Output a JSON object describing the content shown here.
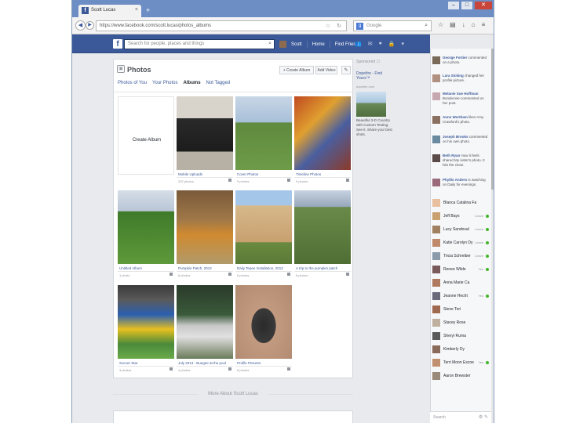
{
  "browser": {
    "tab_title": "Scott Lucas",
    "new_tab_glyph": "+",
    "close_glyph": "×",
    "url": "https://www.facebook.com/scott.lucas/photos_albums",
    "search_placeholder": "Google",
    "window_buttons": [
      "–",
      "□",
      "✕"
    ]
  },
  "fb": {
    "search_placeholder": "Search for people, places and things",
    "user_name": "Scott",
    "home": "Home",
    "find_friends": "Find Friends"
  },
  "photos": {
    "title": "Photos",
    "create_album_button": "+ Create Album",
    "add_video_button": "Add Video",
    "tabs": [
      "Photos of You",
      "Your Photos",
      "Albums",
      "Not Tagged"
    ],
    "create_album_tile": "Create Album",
    "albums": [
      {
        "name": "Mobile Uploads",
        "count": "232 photos"
      },
      {
        "name": "Cover Photos",
        "count": "9 photos"
      },
      {
        "name": "Timeline Photos",
        "count": "9 photos"
      },
      {
        "name": "Untitled Album",
        "count": "1 photo"
      },
      {
        "name": "Pumpkin Patch, 2012",
        "count": "8 photos"
      },
      {
        "name": "Daily Tepee Installation, 2012",
        "count": "6 photos"
      },
      {
        "name": "A trip to the pumpkin patch",
        "count": "8 photos"
      },
      {
        "name": "Soccer Star",
        "count": "3 photos"
      },
      {
        "name": "July 2013 - Bungee at the pool",
        "count": "4 photos"
      },
      {
        "name": "Profile Pictures",
        "count": "8 photos"
      }
    ],
    "more_about": "More About Scott Lucas"
  },
  "sponsored": {
    "label": "Sponsored",
    "title": "Dopefire - Find Yours™",
    "url": "dopefire.com",
    "text": "Beautiful 3-D Country with Custom Testing. See it. Share your best shots."
  },
  "ticker": [
    {
      "name": "George Fortier",
      "text": "commented on a photo."
    },
    {
      "name": "Lara Sicking",
      "text": "changed her profile picture."
    },
    {
      "name": "Melanie Sue Hoffman",
      "text": "Bonderose commented on her post."
    },
    {
      "name": "Anne Wortham",
      "text": "likes Amy Crawford's photo."
    },
    {
      "name": "Joseph Brooks",
      "text": "commented on his own photo."
    },
    {
      "name": "Beth Ryan",
      "text": "How it feels shared My sister's photo. It hits the close."
    },
    {
      "name": "Phyllis Anders",
      "text": "is watching on Daily for evenings."
    }
  ],
  "chat": [
    {
      "name": "Blanca Catalina Fagan",
      "status": ""
    },
    {
      "name": "Jeff Bays",
      "status": "Leave"
    },
    {
      "name": "Lucy Sandoval",
      "status": "Leave"
    },
    {
      "name": "Katie Carolyn Dy",
      "status": "Leave"
    },
    {
      "name": "Tricia Schreiber",
      "status": "Leave"
    },
    {
      "name": "Renee Wilde",
      "status": "Yes"
    },
    {
      "name": "Anna Marie Ca",
      "status": ""
    },
    {
      "name": "Jeanne Hecht",
      "status": "Yes"
    },
    {
      "name": "Steve Tori",
      "status": ""
    },
    {
      "name": "Stacey Rose",
      "status": ""
    },
    {
      "name": "Sheryl Ruma",
      "status": ""
    },
    {
      "name": "Kimberly Dy",
      "status": ""
    },
    {
      "name": "Terri Moon Escoe",
      "status": "Yes"
    },
    {
      "name": "Aaron Brewster",
      "status": ""
    }
  ],
  "chat_search": "Search",
  "colors": {
    "fb_blue": "#3b5998",
    "online": "#42b72a"
  }
}
